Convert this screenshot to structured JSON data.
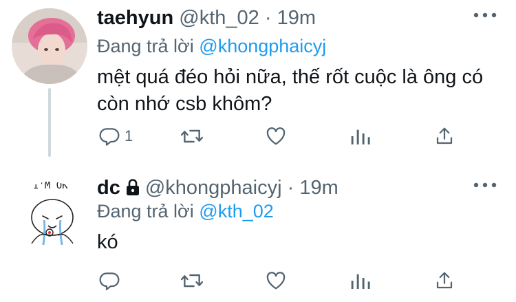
{
  "tweets": [
    {
      "name": "taehyun",
      "handle": "@kth_02",
      "separator": "·",
      "time": "19m",
      "replying_prefix": "Đang trả lời",
      "replying_to": "@khongphaicyj",
      "text_line1": "mệt quá đéo hỏi nữa, thế rốt cuộc là ông có",
      "text_line2": "còn nhớ csb khôm?",
      "reply_count": "1",
      "locked": false,
      "avatar": "photo-person-pink-hair"
    },
    {
      "name": "dc",
      "handle": "@khongphaicyj",
      "separator": "·",
      "time": "19m",
      "replying_prefix": "Đang trả lời",
      "replying_to": "@kth_02",
      "text_line1": "kó",
      "reply_count": "",
      "locked": true,
      "avatar_caption": "I'M OK",
      "avatar": "crying-cartoon-doodle"
    }
  ],
  "icons": {
    "reply": "reply-icon",
    "retweet": "retweet-icon",
    "like": "like-icon",
    "analytics": "analytics-icon",
    "share": "share-icon",
    "more": "more-icon",
    "lock": "lock-icon"
  },
  "colors": {
    "text": "#0f1419",
    "secondary": "#536471",
    "link": "#1d9bf0",
    "thread_line": "#cfd9de"
  }
}
